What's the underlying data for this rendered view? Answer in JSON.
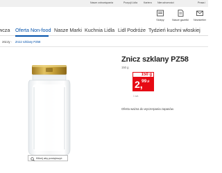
{
  "topbar": {
    "links": [
      "Nasze zobowiązania",
      "Pozycji Lidla",
      "Kariera",
      "Nieruchomości",
      "Prasa i"
    ]
  },
  "header": {
    "icons": [
      {
        "name": "list-icon",
        "label": "Sklepy"
      },
      {
        "name": "paper-icon",
        "label": "Nasze gazetki"
      },
      {
        "name": "mail-icon",
        "label": "Newsletter"
      }
    ]
  },
  "nav": {
    "items": [
      "wcza",
      "Oferta Non-food",
      "Nasze Marki",
      "Kuchnia Lidla",
      "Lidl Podróże",
      "Tydzień kuchni włoskiej"
    ],
    "active_index": 1
  },
  "breadcrumb": {
    "items": [
      "zniczy",
      "Znicz szklany PZ58"
    ]
  },
  "product": {
    "title": "Znicz szklany PZ58",
    "weight": "150 g",
    "old_price": "150 g",
    "price_int": "2,",
    "price_dec": "99",
    "currency": "zł",
    "unit_note": "1 szt.",
    "description": "Oferta ważna do wyczerpania zapasów.",
    "zoom_label": "Kliknij aby powiększyć"
  },
  "colors": {
    "accent": "#0050aa",
    "price_red": "#e60a14",
    "lid_gold": "#c9a33a"
  }
}
